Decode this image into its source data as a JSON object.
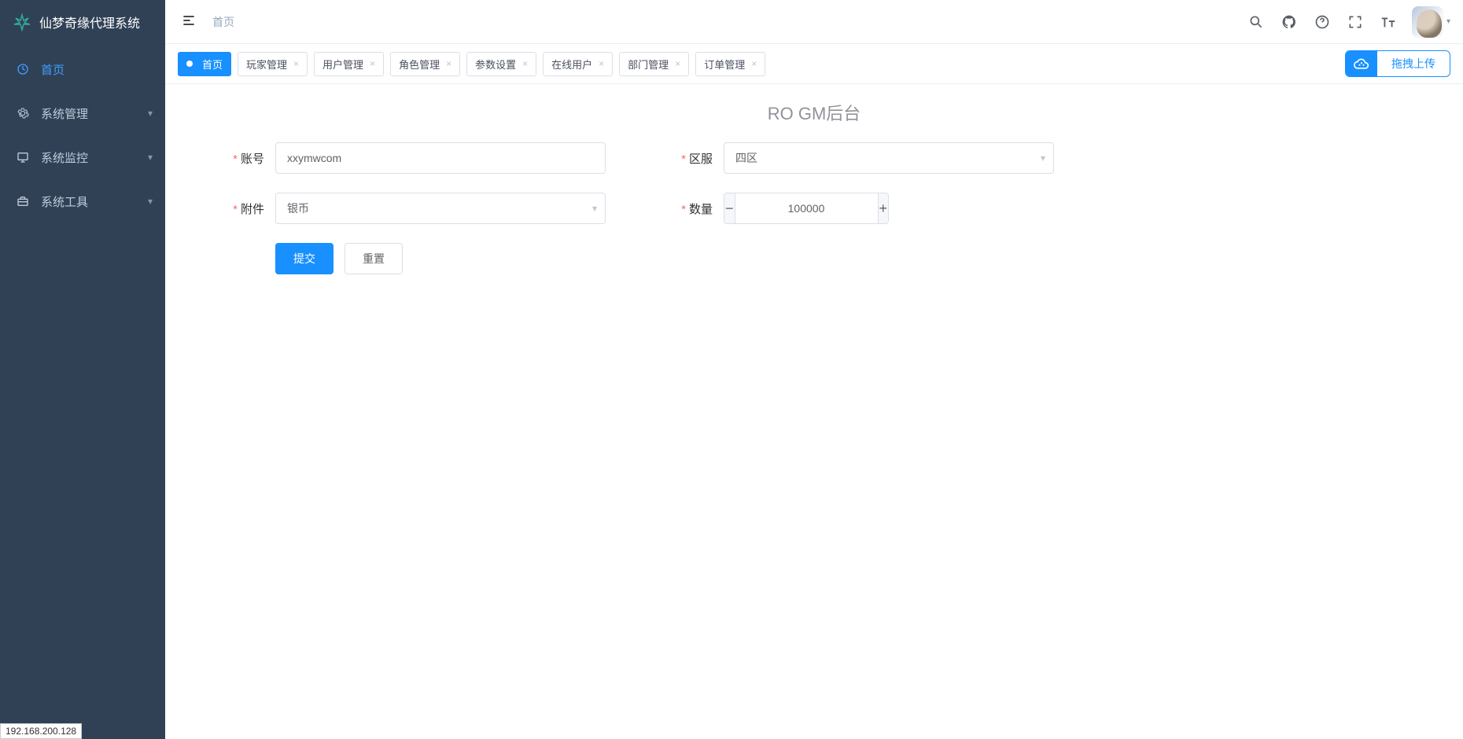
{
  "app": {
    "name": "仙梦奇缘代理系统"
  },
  "sidebar": {
    "items": [
      {
        "label": "首页",
        "icon": "dashboard",
        "active": true,
        "expandable": false
      },
      {
        "label": "系统管理",
        "icon": "gear",
        "active": false,
        "expandable": true
      },
      {
        "label": "系统监控",
        "icon": "monitor",
        "active": false,
        "expandable": true
      },
      {
        "label": "系统工具",
        "icon": "toolbox",
        "active": false,
        "expandable": true
      }
    ]
  },
  "breadcrumb": "首页",
  "tabs": [
    {
      "label": "首页",
      "closable": false,
      "active": true
    },
    {
      "label": "玩家管理",
      "closable": true,
      "active": false
    },
    {
      "label": "用户管理",
      "closable": true,
      "active": false
    },
    {
      "label": "角色管理",
      "closable": true,
      "active": false
    },
    {
      "label": "参数设置",
      "closable": true,
      "active": false
    },
    {
      "label": "在线用户",
      "closable": true,
      "active": false
    },
    {
      "label": "部门管理",
      "closable": true,
      "active": false
    },
    {
      "label": "订单管理",
      "closable": true,
      "active": false
    }
  ],
  "upload": {
    "label": "拖拽上传"
  },
  "page": {
    "title": "RO GM后台"
  },
  "form": {
    "account": {
      "label": "账号",
      "value": "xxymwcom"
    },
    "zone": {
      "label": "区服",
      "value": "四区"
    },
    "attach": {
      "label": "附件",
      "value": "银币"
    },
    "qty": {
      "label": "数量",
      "value": "100000"
    },
    "submit": "提交",
    "reset": "重置"
  },
  "status": "192.168.200.128"
}
